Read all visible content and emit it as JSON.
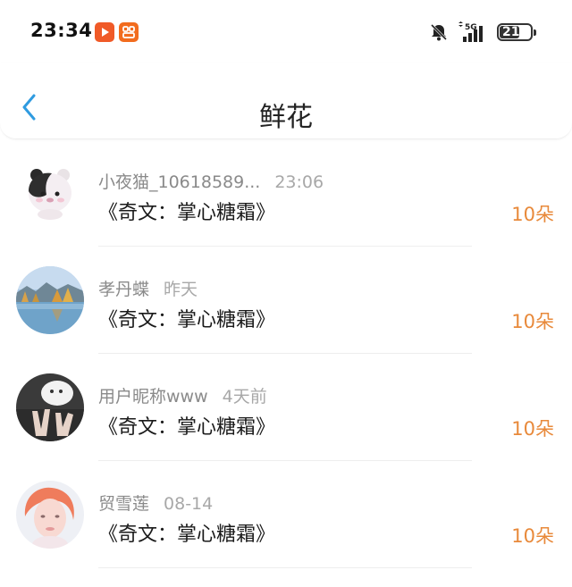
{
  "status_bar": {
    "time": "23:34",
    "network": "5G",
    "battery": "21"
  },
  "header": {
    "title": "鲜花",
    "back_icon": "chevron-left-icon"
  },
  "list": [
    {
      "name": "小夜猫_10618589...",
      "time": "23:06",
      "book": "《奇文：掌心糖霜》",
      "count": "10朵"
    },
    {
      "name": "孝丹蝶",
      "time": "昨天",
      "book": "《奇文：掌心糖霜》",
      "count": "10朵"
    },
    {
      "name": "用户昵称www",
      "time": "4天前",
      "book": "《奇文：掌心糖霜》",
      "count": "10朵"
    },
    {
      "name": "贸雪莲",
      "time": "08-14",
      "book": "《奇文：掌心糖霜》",
      "count": "10朵"
    }
  ],
  "colors": {
    "accent": "#2f9be0",
    "count": "#e8893a",
    "secondary_text": "#8a8a8a"
  }
}
